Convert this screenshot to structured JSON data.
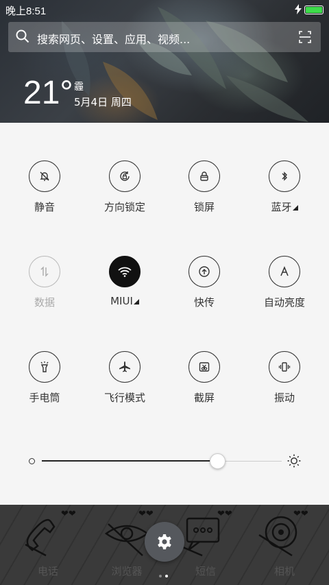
{
  "status_bar": {
    "time": "晚上8:51",
    "charging_icon": "bolt-icon",
    "battery_icon": "battery-icon",
    "battery_color": "#3ddc4a"
  },
  "search": {
    "placeholder": "搜索网页、设置、应用、视频...",
    "scan_icon": "scan-icon"
  },
  "weather": {
    "temperature": "21°",
    "condition": "霾",
    "date": "5月4日 周四"
  },
  "quick_toggles": [
    {
      "label": "静音",
      "icon": "bell-off-icon"
    },
    {
      "label": "方向锁定",
      "icon": "rotation-lock-icon"
    },
    {
      "label": "锁屏",
      "icon": "lock-icon"
    },
    {
      "label": "蓝牙",
      "icon": "bluetooth-icon"
    },
    {
      "label": "数据",
      "icon": "mobile-data-icon",
      "state": "disabled"
    },
    {
      "label": "MIUI",
      "icon": "wifi-icon",
      "state": "on"
    },
    {
      "label": "快传",
      "icon": "upload-icon"
    },
    {
      "label": "自动亮度",
      "icon": "auto-brightness-icon"
    },
    {
      "label": "手电筒",
      "icon": "flashlight-icon"
    },
    {
      "label": "飞行模式",
      "icon": "airplane-icon"
    },
    {
      "label": "截屏",
      "icon": "screenshot-icon"
    },
    {
      "label": "振动",
      "icon": "vibrate-icon"
    }
  ],
  "brightness": {
    "level_fraction": 0.73,
    "low_icon": "brightness-low-icon",
    "high_icon": "sun-icon"
  },
  "dock": {
    "apps": [
      {
        "label": "电话",
        "icon": "phone-icon"
      },
      {
        "label": "浏览器",
        "icon": "browser-icon"
      },
      {
        "label": "短信",
        "icon": "message-icon"
      },
      {
        "label": "相机",
        "icon": "camera-icon"
      }
    ],
    "settings_icon": "gear-icon",
    "pages": 2,
    "active_page": 1
  }
}
